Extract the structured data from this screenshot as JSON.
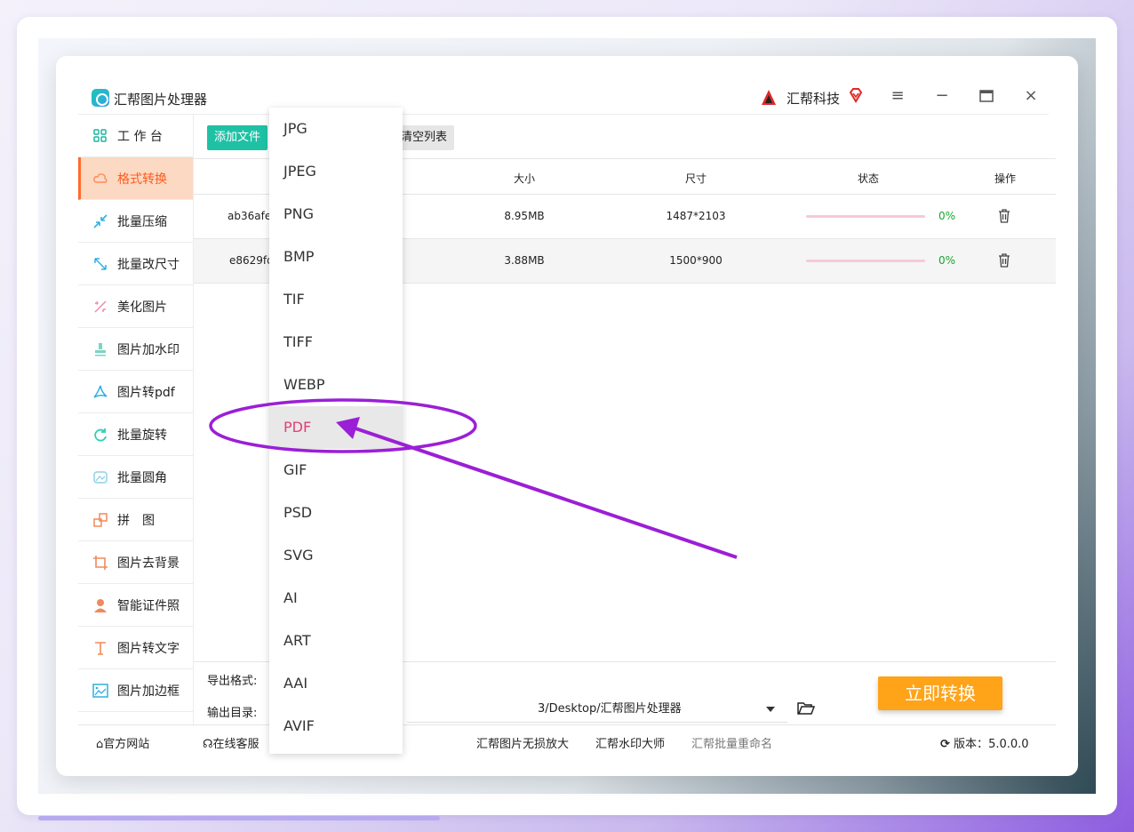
{
  "app": {
    "title": "汇帮图片处理器",
    "brand": "汇帮科技"
  },
  "sidebar": {
    "items": [
      {
        "label": "工 作 台",
        "icon": "grid-icon"
      },
      {
        "label": "格式转换",
        "icon": "cloud-convert-icon",
        "active": true
      },
      {
        "label": "批量压缩",
        "icon": "compress-icon"
      },
      {
        "label": "批量改尺寸",
        "icon": "resize-icon"
      },
      {
        "label": "美化图片",
        "icon": "beautify-icon"
      },
      {
        "label": "图片加水印",
        "icon": "stamp-icon"
      },
      {
        "label": "图片转pdf",
        "icon": "pdf-icon"
      },
      {
        "label": "批量旋转",
        "icon": "rotate-icon"
      },
      {
        "label": "批量圆角",
        "icon": "round-corner-icon"
      },
      {
        "label": "拼　图",
        "icon": "puzzle-icon"
      },
      {
        "label": "图片去背景",
        "icon": "crop-icon"
      },
      {
        "label": "智能证件照",
        "icon": "person-icon"
      },
      {
        "label": "图片转文字",
        "icon": "text-icon"
      },
      {
        "label": "图片加边框",
        "icon": "frame-icon"
      }
    ]
  },
  "toolbar": {
    "add_label": "添加文件",
    "clear_label": "清空列表"
  },
  "table": {
    "headers": [
      "大小",
      "尺寸",
      "状态",
      "操作"
    ],
    "rows": [
      {
        "name": "ab36afe",
        "size": "8.95MB",
        "dims": "1487*2103",
        "progress": 0,
        "pct": "0%"
      },
      {
        "name": "e8629fd",
        "size": "3.88MB",
        "dims": "1500*900",
        "progress": 0,
        "pct": "0%"
      }
    ]
  },
  "options": {
    "format_label": "导出格式:",
    "dir_label": "输出目录:",
    "dir_value": "3/Desktop/汇帮图片处理器",
    "convert_label": "立即转换"
  },
  "footer": {
    "website": "官方网站",
    "support": "在线客服",
    "link1": "汇帮图片无损放大",
    "link2": "汇帮水印大师",
    "link3": "汇帮批量重命名",
    "version_label": "版本：",
    "version": "5.0.0.0"
  },
  "dropdown": {
    "options": [
      "JPG",
      "JPEG",
      "PNG",
      "BMP",
      "TIF",
      "TIFF",
      "WEBP",
      "PDF",
      "GIF",
      "PSD",
      "SVG",
      "AI",
      "ART",
      "AAI",
      "AVIF"
    ],
    "selected": "PDF"
  },
  "colors": {
    "accent_teal": "#1fc1a5",
    "active_orange": "#ff5a1f",
    "convert_orange": "#ffa318",
    "progress_pink": "#f7c9d6",
    "pct_green": "#18a62f",
    "annotation_purple": "#9b1fd6",
    "selected_pink": "#e53d76"
  }
}
